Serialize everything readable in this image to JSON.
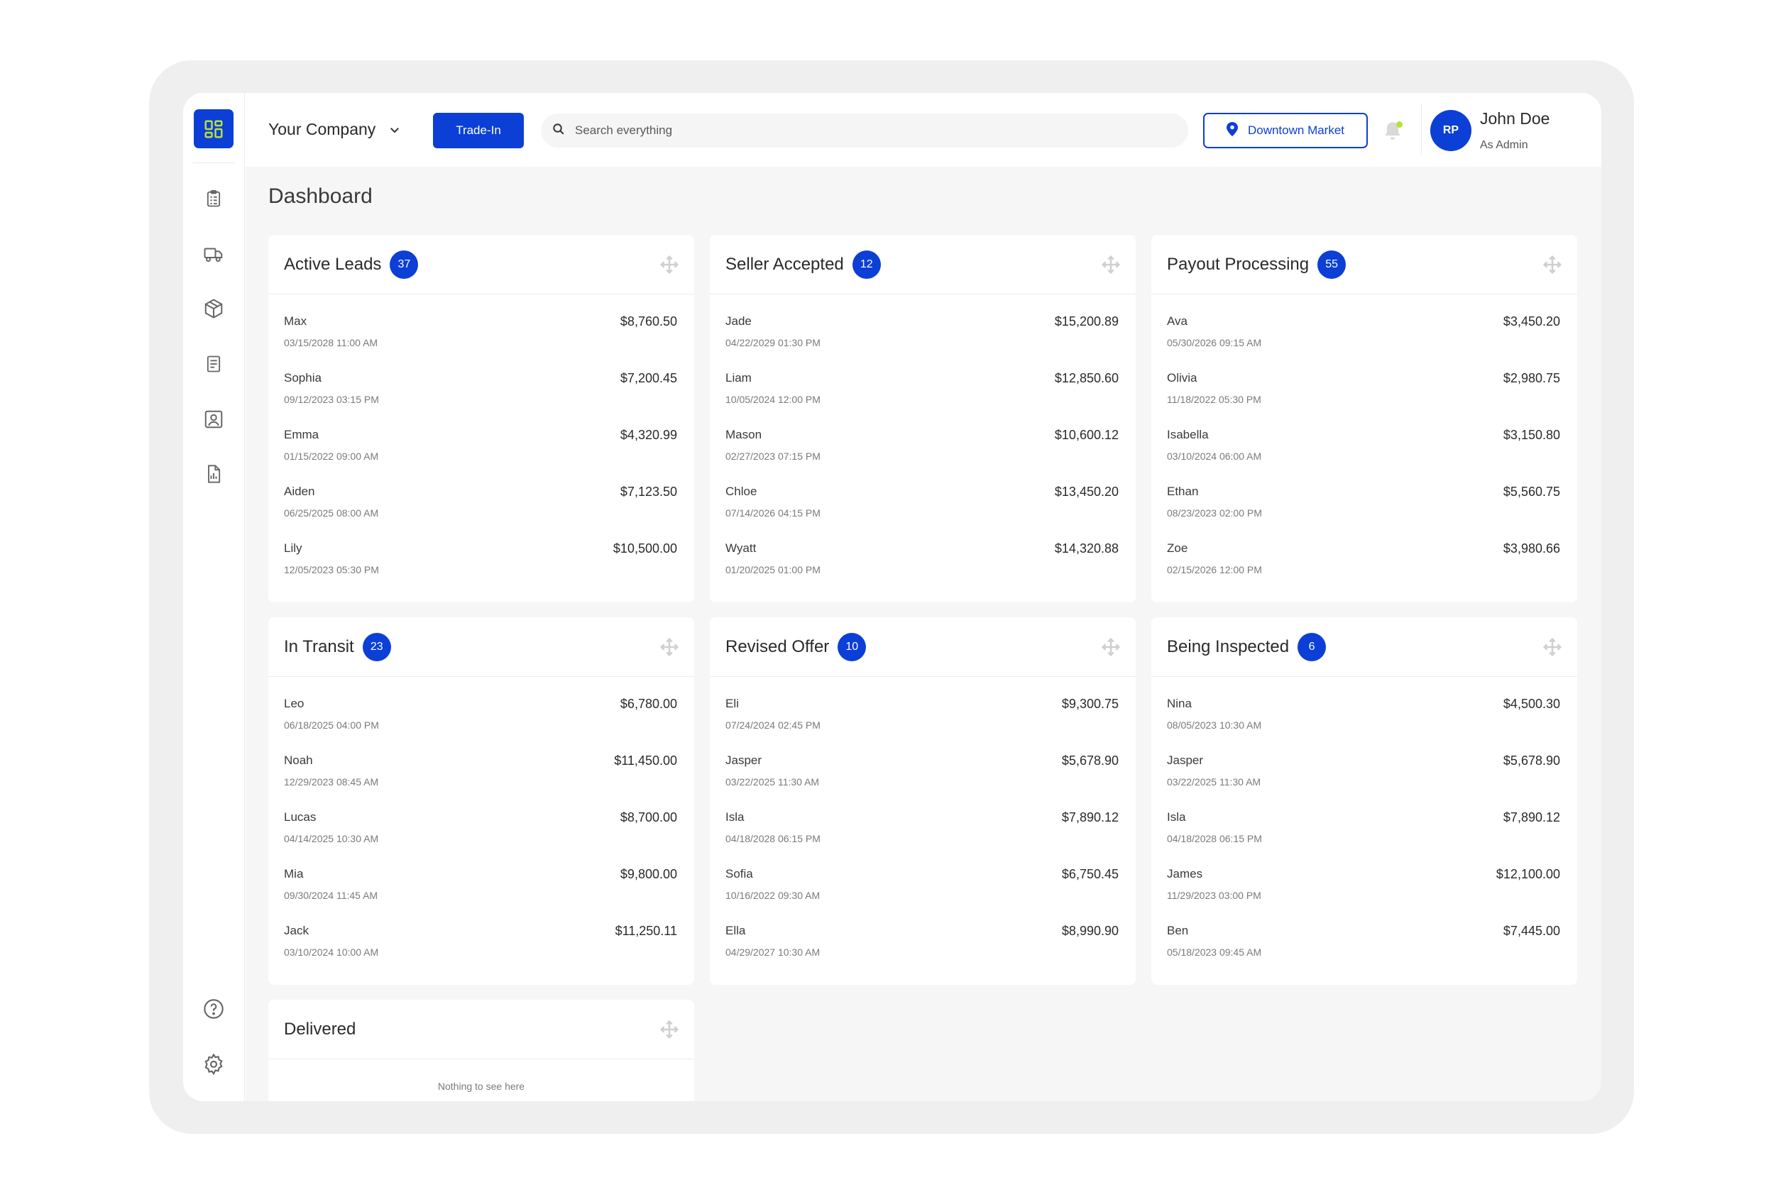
{
  "company": {
    "name": "Your Company"
  },
  "header": {
    "trade_in_label": "Trade-In",
    "search_placeholder": "Search everything",
    "market_label": "Downtown Market"
  },
  "user": {
    "initials": "RP",
    "name": "John Doe",
    "role": "As Admin"
  },
  "page": {
    "title": "Dashboard"
  },
  "colors": {
    "brand": "#0b3fd6",
    "accent": "#b9e03a",
    "background": "#f6f6f6"
  },
  "sidebar": {
    "icons": [
      "dashboard-icon",
      "clipboard-icon",
      "truck-icon",
      "package-icon",
      "receipt-icon",
      "contact-icon",
      "report-icon",
      "help-icon",
      "settings-icon"
    ]
  },
  "cards": [
    {
      "title": "Active Leads",
      "count": "37",
      "rows": [
        {
          "name": "Max",
          "date": "03/15/2028 11:00 AM",
          "amount": "$8,760.50"
        },
        {
          "name": "Sophia",
          "date": "09/12/2023 03:15 PM",
          "amount": "$7,200.45"
        },
        {
          "name": "Emma",
          "date": "01/15/2022 09:00 AM",
          "amount": "$4,320.99"
        },
        {
          "name": "Aiden",
          "date": "06/25/2025 08:00 AM",
          "amount": "$7,123.50"
        },
        {
          "name": "Lily",
          "date": "12/05/2023 05:30 PM",
          "amount": "$10,500.00"
        }
      ]
    },
    {
      "title": "Seller Accepted",
      "count": "12",
      "rows": [
        {
          "name": "Jade",
          "date": "04/22/2029 01:30 PM",
          "amount": "$15,200.89"
        },
        {
          "name": "Liam",
          "date": "10/05/2024 12:00 PM",
          "amount": "$12,850.60"
        },
        {
          "name": "Mason",
          "date": "02/27/2023 07:15 PM",
          "amount": "$10,600.12"
        },
        {
          "name": "Chloe",
          "date": "07/14/2026 04:15 PM",
          "amount": "$13,450.20"
        },
        {
          "name": "Wyatt",
          "date": "01/20/2025 01:00 PM",
          "amount": "$14,320.88"
        }
      ]
    },
    {
      "title": "Payout Processing",
      "count": "55",
      "rows": [
        {
          "name": "Ava",
          "date": "05/30/2026 09:15 AM",
          "amount": "$3,450.20"
        },
        {
          "name": "Olivia",
          "date": "11/18/2022 05:30 PM",
          "amount": "$2,980.75"
        },
        {
          "name": "Isabella",
          "date": "03/10/2024 06:00 AM",
          "amount": "$3,150.80"
        },
        {
          "name": "Ethan",
          "date": "08/23/2023 02:00 PM",
          "amount": "$5,560.75"
        },
        {
          "name": "Zoe",
          "date": "02/15/2026 12:00 PM",
          "amount": "$3,980.66"
        }
      ]
    },
    {
      "title": "In Transit",
      "count": "23",
      "rows": [
        {
          "name": "Leo",
          "date": "06/18/2025 04:00 PM",
          "amount": "$6,780.00"
        },
        {
          "name": "Noah",
          "date": "12/29/2023 08:45 AM",
          "amount": "$11,450.00"
        },
        {
          "name": "Lucas",
          "date": "04/14/2025 10:30 AM",
          "amount": "$8,700.00"
        },
        {
          "name": "Mia",
          "date": "09/30/2024 11:45 AM",
          "amount": "$9,800.00"
        },
        {
          "name": "Jack",
          "date": "03/10/2024 10:00 AM",
          "amount": "$11,250.11"
        }
      ]
    },
    {
      "title": "Revised Offer",
      "count": "10",
      "rows": [
        {
          "name": "Eli",
          "date": "07/24/2024 02:45 PM",
          "amount": "$9,300.75"
        },
        {
          "name": "Jasper",
          "date": "03/22/2025 11:30 AM",
          "amount": "$5,678.90"
        },
        {
          "name": "Isla",
          "date": "04/18/2028 06:15 PM",
          "amount": "$7,890.12"
        },
        {
          "name": "Sofia",
          "date": "10/16/2022 09:30 AM",
          "amount": "$6,750.45"
        },
        {
          "name": "Ella",
          "date": "04/29/2027 10:30 AM",
          "amount": "$8,990.90"
        }
      ]
    },
    {
      "title": "Being Inspected",
      "count": "6",
      "rows": [
        {
          "name": "Nina",
          "date": "08/05/2023 10:30 AM",
          "amount": "$4,500.30"
        },
        {
          "name": "Jasper",
          "date": "03/22/2025 11:30 AM",
          "amount": "$5,678.90"
        },
        {
          "name": "Isla",
          "date": "04/18/2028 06:15 PM",
          "amount": "$7,890.12"
        },
        {
          "name": "James",
          "date": "11/29/2023 03:00 PM",
          "amount": "$12,100.00"
        },
        {
          "name": "Ben",
          "date": "05/18/2023 09:45 AM",
          "amount": "$7,445.00"
        }
      ]
    },
    {
      "title": "Delivered",
      "count": "",
      "empty_text": "Nothing to see here",
      "rows": []
    }
  ]
}
